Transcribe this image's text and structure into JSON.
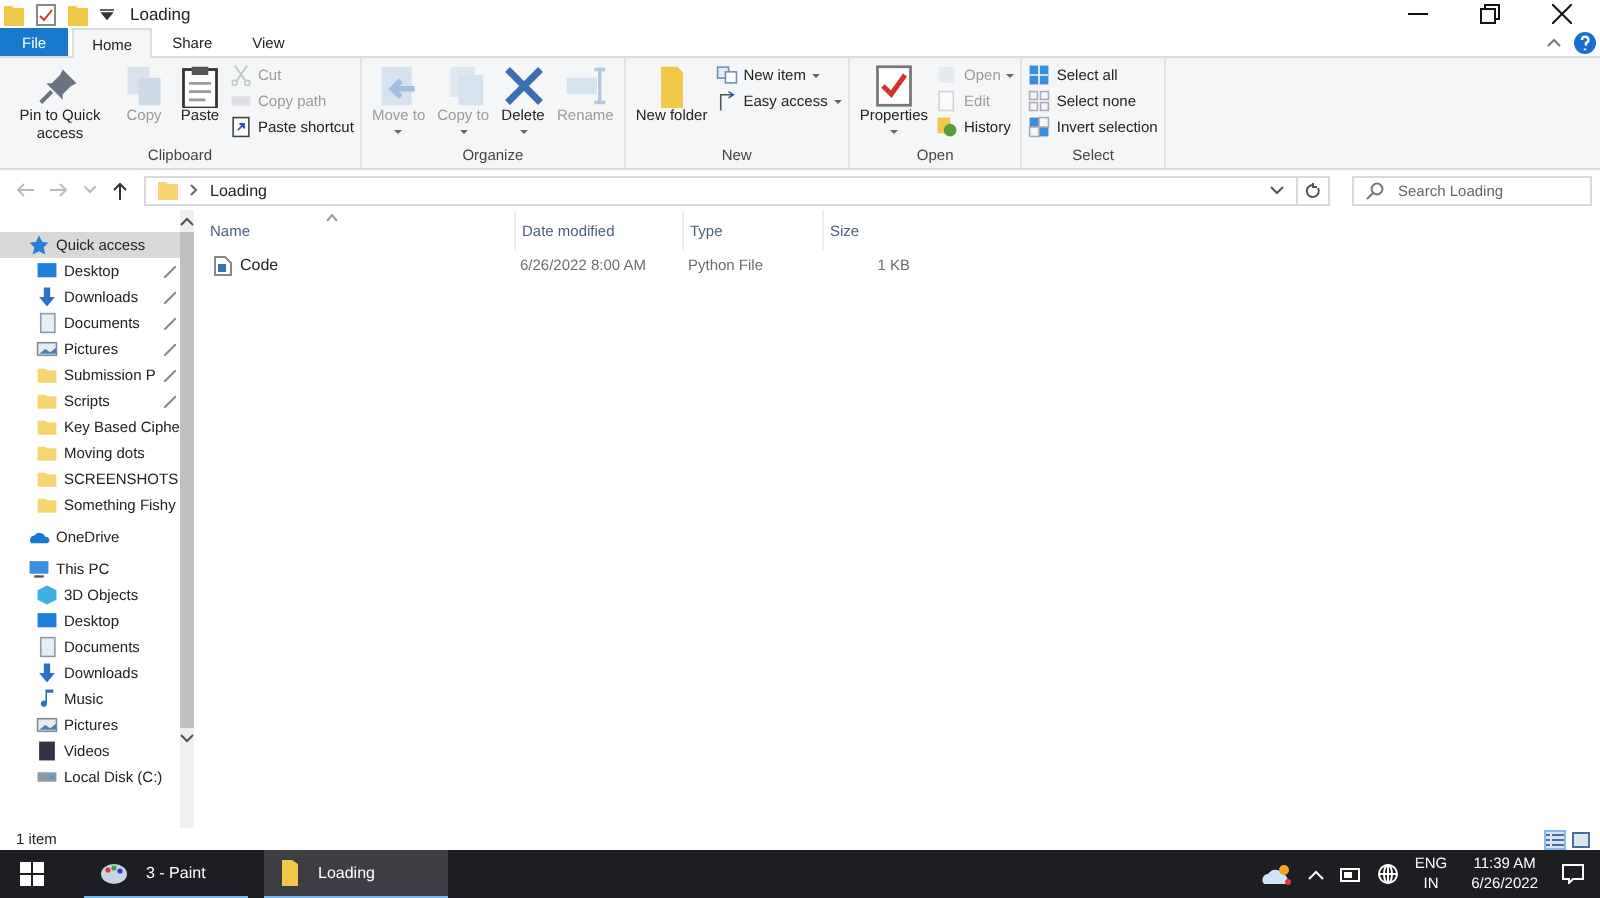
{
  "window": {
    "title": "Loading"
  },
  "tabs": [
    {
      "label": "File",
      "kind": "file",
      "selected": false
    },
    {
      "label": "Home",
      "kind": "tab",
      "selected": true
    },
    {
      "label": "Share",
      "kind": "tab",
      "selected": false
    },
    {
      "label": "View",
      "kind": "tab",
      "selected": false
    }
  ],
  "ribbon": {
    "groups": [
      {
        "name": "Clipboard",
        "large": [
          {
            "label": "Pin to Quick access",
            "disabled": false,
            "has_menu": false
          },
          {
            "label": "Copy",
            "disabled": true,
            "has_menu": false
          },
          {
            "label": "Paste",
            "disabled": false,
            "has_menu": false
          }
        ],
        "small": [
          {
            "label": "Cut",
            "disabled": true,
            "has_menu": false
          },
          {
            "label": "Copy path",
            "disabled": true,
            "has_menu": false
          },
          {
            "label": "Paste shortcut",
            "disabled": false,
            "has_menu": false
          }
        ]
      },
      {
        "name": "Organize",
        "large": [
          {
            "label": "Move to",
            "disabled": true,
            "has_menu": true
          },
          {
            "label": "Copy to",
            "disabled": true,
            "has_menu": true
          },
          {
            "label": "Delete",
            "disabled": false,
            "has_menu": true
          },
          {
            "label": "Rename",
            "disabled": true,
            "has_menu": false
          }
        ]
      },
      {
        "name": "New",
        "large": [
          {
            "label": "New folder",
            "disabled": false,
            "has_menu": false
          }
        ],
        "small": [
          {
            "label": "New item",
            "disabled": false,
            "has_menu": true
          },
          {
            "label": "Easy access",
            "disabled": false,
            "has_menu": true
          }
        ]
      },
      {
        "name": "Open",
        "large": [
          {
            "label": "Properties",
            "disabled": false,
            "has_menu": true
          }
        ],
        "small": [
          {
            "label": "Open",
            "disabled": true,
            "has_menu": true
          },
          {
            "label": "Edit",
            "disabled": true,
            "has_menu": false
          },
          {
            "label": "History",
            "disabled": false,
            "has_menu": false
          }
        ]
      },
      {
        "name": "Select",
        "small": [
          {
            "label": "Select all",
            "disabled": false,
            "has_menu": false
          },
          {
            "label": "Select none",
            "disabled": false,
            "has_menu": false
          },
          {
            "label": "Invert selection",
            "disabled": false,
            "has_menu": false
          }
        ]
      }
    ]
  },
  "address_bar": {
    "path": [
      "Loading"
    ]
  },
  "search": {
    "placeholder": "Search Loading"
  },
  "navigation": [
    {
      "label": "Quick access",
      "kind": "star",
      "selected": true,
      "children": [
        {
          "label": "Desktop",
          "kind": "desktop",
          "selected": false,
          "pinned": true
        },
        {
          "label": "Downloads",
          "kind": "download",
          "selected": false,
          "pinned": true
        },
        {
          "label": "Documents",
          "kind": "documents",
          "selected": false,
          "pinned": true
        },
        {
          "label": "Pictures",
          "kind": "pictures",
          "selected": false,
          "pinned": true
        },
        {
          "label": "Submission P",
          "kind": "folder",
          "selected": false,
          "pinned": true
        },
        {
          "label": "Scripts",
          "kind": "folder",
          "selected": false,
          "pinned": true
        },
        {
          "label": "Key Based Ciphe",
          "kind": "folder",
          "selected": false,
          "pinned": false
        },
        {
          "label": "Moving dots",
          "kind": "folder",
          "selected": false,
          "pinned": false
        },
        {
          "label": "SCREENSHOTS",
          "kind": "folder",
          "selected": false,
          "pinned": false
        },
        {
          "label": "Something Fishy",
          "kind": "folder",
          "selected": false,
          "pinned": false
        }
      ]
    },
    {
      "label": "OneDrive",
      "kind": "cloud",
      "selected": false
    },
    {
      "label": "This PC",
      "kind": "pc",
      "selected": false,
      "children": [
        {
          "label": "3D Objects",
          "kind": "cube",
          "selected": false,
          "pinned": false
        },
        {
          "label": "Desktop",
          "kind": "desktop",
          "selected": false,
          "pinned": false
        },
        {
          "label": "Documents",
          "kind": "documents",
          "selected": false,
          "pinned": false
        },
        {
          "label": "Downloads",
          "kind": "download",
          "selected": false,
          "pinned": false
        },
        {
          "label": "Music",
          "kind": "music",
          "selected": false,
          "pinned": false
        },
        {
          "label": "Pictures",
          "kind": "pictures",
          "selected": false,
          "pinned": false
        },
        {
          "label": "Videos",
          "kind": "videos",
          "selected": false,
          "pinned": false
        },
        {
          "label": "Local Disk (C:)",
          "kind": "disk",
          "selected": false,
          "pinned": false
        }
      ]
    }
  ],
  "table": {
    "columns": [
      "Name",
      "Date modified",
      "Type",
      "Size"
    ],
    "rows": [
      {
        "cells": [
          "Code",
          "6/26/2022 8:00 AM",
          "Python File",
          "1 KB"
        ],
        "selected": false
      }
    ]
  },
  "status_bar": {
    "text": "1 item",
    "views": [
      {
        "kind": "details",
        "selected": true
      },
      {
        "kind": "large",
        "selected": false
      }
    ]
  },
  "taskbar": {
    "apps": [
      {
        "label": "3 - Paint",
        "kind": "paint",
        "selected": false
      },
      {
        "label": "Loading",
        "kind": "folder",
        "selected": true
      }
    ],
    "language": [
      "ENG",
      "IN"
    ],
    "time": "11:39 AM",
    "date": "6/26/2022"
  }
}
